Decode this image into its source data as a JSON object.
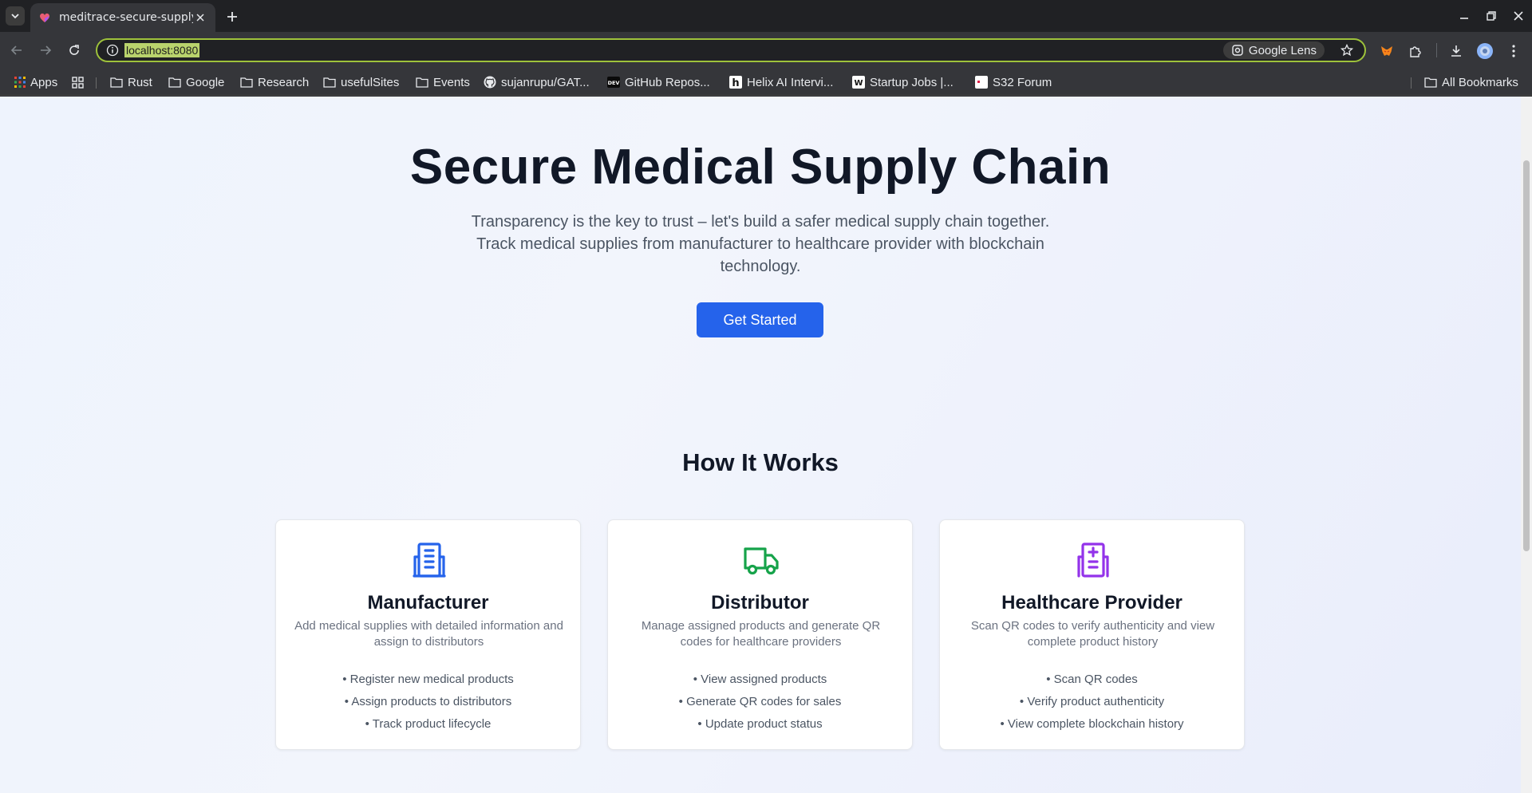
{
  "browser": {
    "tab": {
      "title": "meditrace-secure-supply"
    },
    "address": {
      "url": "localhost:8080"
    },
    "lens_label": "Google Lens",
    "bookmarks": [
      {
        "label": "Apps",
        "icon": "apps-grid-icon"
      },
      {
        "label": "Rust",
        "icon": "folder-icon"
      },
      {
        "label": "Google",
        "icon": "folder-icon"
      },
      {
        "label": "Research",
        "icon": "folder-icon"
      },
      {
        "label": "usefulSites",
        "icon": "folder-icon"
      },
      {
        "label": "Events",
        "icon": "folder-icon"
      },
      {
        "label": "sujanrupu/GAT...",
        "icon": "github-icon"
      },
      {
        "label": "GitHub Repos...",
        "icon": "dev-icon"
      },
      {
        "label": "Helix AI Intervi...",
        "icon": "helix-icon"
      },
      {
        "label": "Startup Jobs |...",
        "icon": "wellfound-icon"
      },
      {
        "label": "S32 Forum",
        "icon": "s32-icon"
      }
    ],
    "all_bookmarks": "All Bookmarks"
  },
  "page": {
    "hero": {
      "title": "Secure Medical Supply Chain",
      "subtitle": "Transparency is the key to trust – let's build a safer medical supply chain together. Track medical supplies from manufacturer to healthcare provider with blockchain technology.",
      "cta_label": "Get Started"
    },
    "how": {
      "title": "How It Works",
      "cards": [
        {
          "title": "Manufacturer",
          "description": "Add medical supplies with detailed information and assign to distributors",
          "icon": "building-icon",
          "color": "#2563eb",
          "items": [
            "• Register new medical products",
            "• Assign products to distributors",
            "• Track product lifecycle"
          ]
        },
        {
          "title": "Distributor",
          "description": "Manage assigned products and generate QR codes for healthcare providers",
          "icon": "truck-icon",
          "color": "#16a34a",
          "items": [
            "• View assigned products",
            "• Generate QR codes for sales",
            "• Update product status"
          ]
        },
        {
          "title": "Healthcare Provider",
          "description": "Scan QR codes to verify authenticity and view complete product history",
          "icon": "hospital-icon",
          "color": "#9333ea",
          "items": [
            "• Scan QR codes",
            "• Verify product authenticity",
            "• View complete blockchain history"
          ]
        }
      ]
    }
  }
}
